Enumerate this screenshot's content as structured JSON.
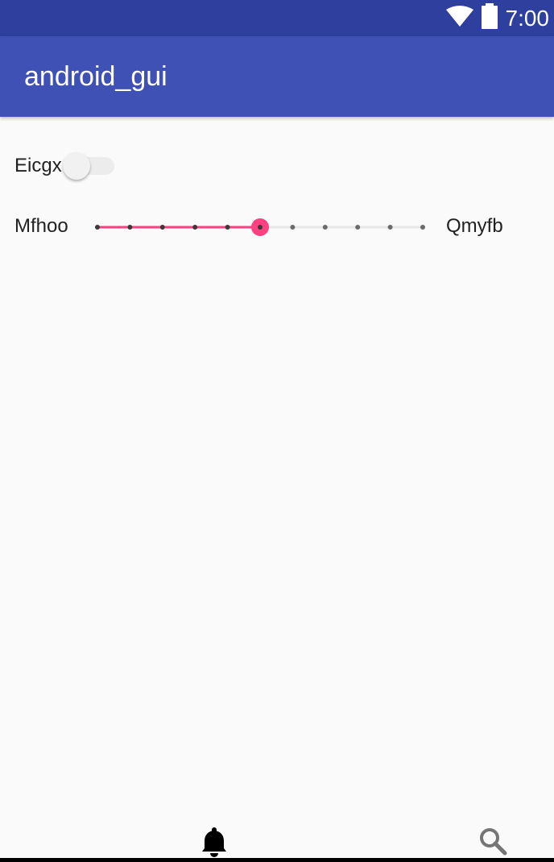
{
  "status_bar": {
    "time": "7:00",
    "icons": [
      "wifi-icon",
      "battery-icon"
    ]
  },
  "app_bar": {
    "title": "android_gui"
  },
  "switch_row": {
    "label": "Eicgx",
    "checked": false
  },
  "slider_row": {
    "left_label": "Mfhoo",
    "right_label": "Qmyfb",
    "min": 0,
    "max": 10,
    "value": 5,
    "ticks": 11
  },
  "bottom_nav": {
    "icons": [
      "bell-icon",
      "search-icon"
    ]
  },
  "colors": {
    "status_bar": "#2f3f9e",
    "app_bar": "#3f51b5",
    "accent": "#ff4081",
    "background": "#fafafa"
  }
}
